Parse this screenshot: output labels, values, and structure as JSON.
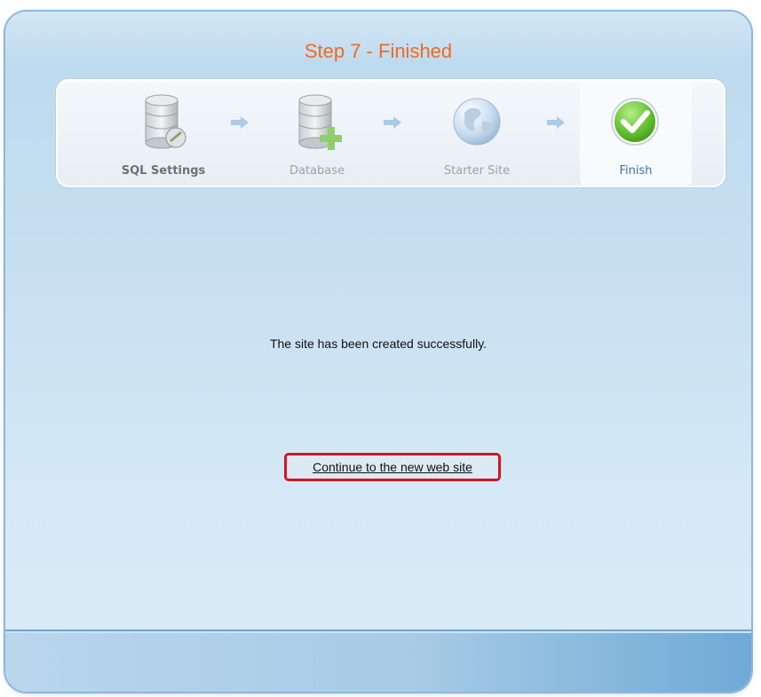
{
  "wizard": {
    "title": "Step 7 - Finished",
    "steps": [
      {
        "label": "SQL Settings",
        "icon": "database-settings-icon",
        "state": "done"
      },
      {
        "label": "Database",
        "icon": "database-add-icon",
        "state": "done"
      },
      {
        "label": "Starter Site",
        "icon": "globe-icon",
        "state": "done"
      },
      {
        "label": "Finish",
        "icon": "checkmark-icon",
        "state": "active"
      }
    ],
    "message": "The site has been created successfully.",
    "continue_link": "Continue to the new web site"
  },
  "colors": {
    "title": "#f06a1e",
    "highlight_border": "#d7141f",
    "active_step_label": "#3c6fa6"
  }
}
